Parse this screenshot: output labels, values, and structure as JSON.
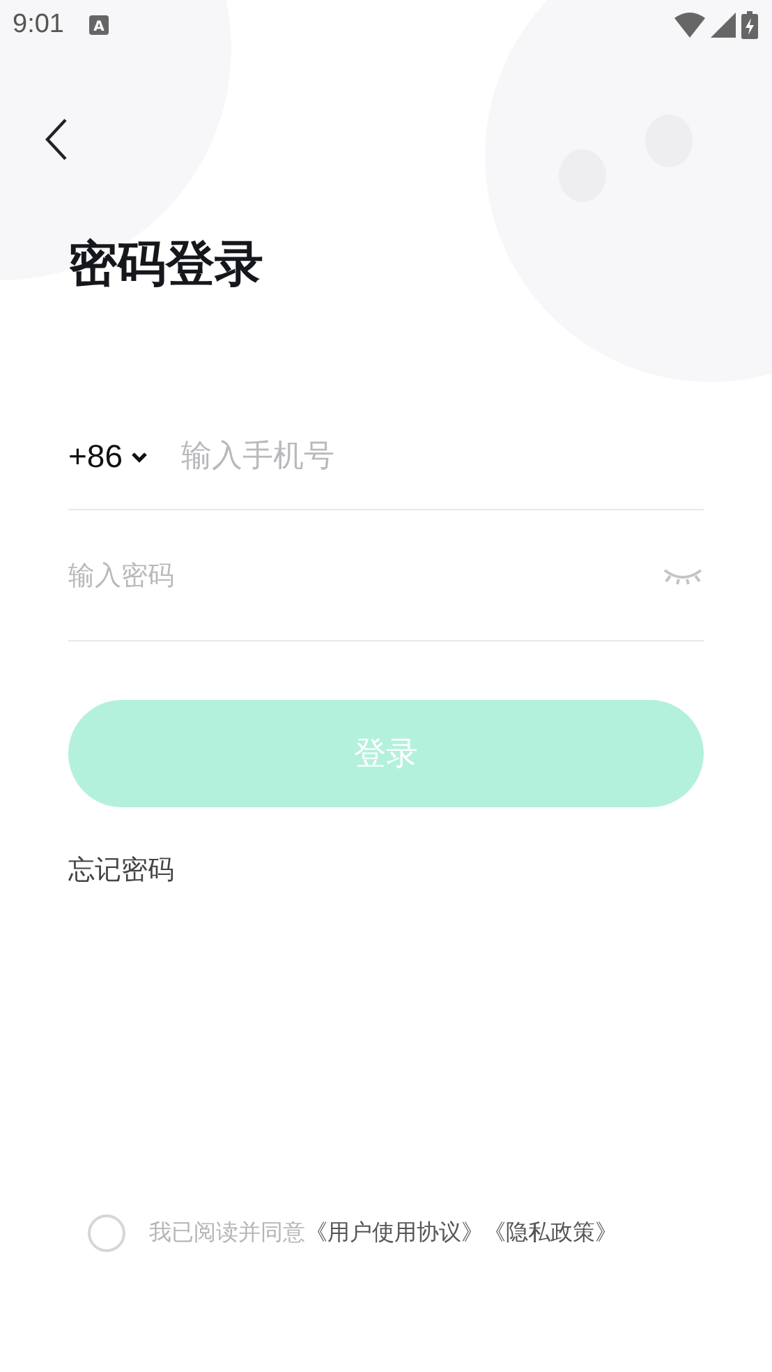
{
  "status_bar": {
    "time": "9:01",
    "input_indicator": "A"
  },
  "title": "密码登录",
  "phone": {
    "country_code": "+86",
    "placeholder": "输入手机号"
  },
  "password": {
    "placeholder": "输入密码",
    "visible": false
  },
  "login_button": {
    "label": "登录",
    "disabled": true
  },
  "forgot_password": "忘记密码",
  "agreement": {
    "checked": false,
    "text": "我已阅读并同意",
    "links": [
      "《用户使用协议》",
      "《隐私政策》"
    ]
  }
}
